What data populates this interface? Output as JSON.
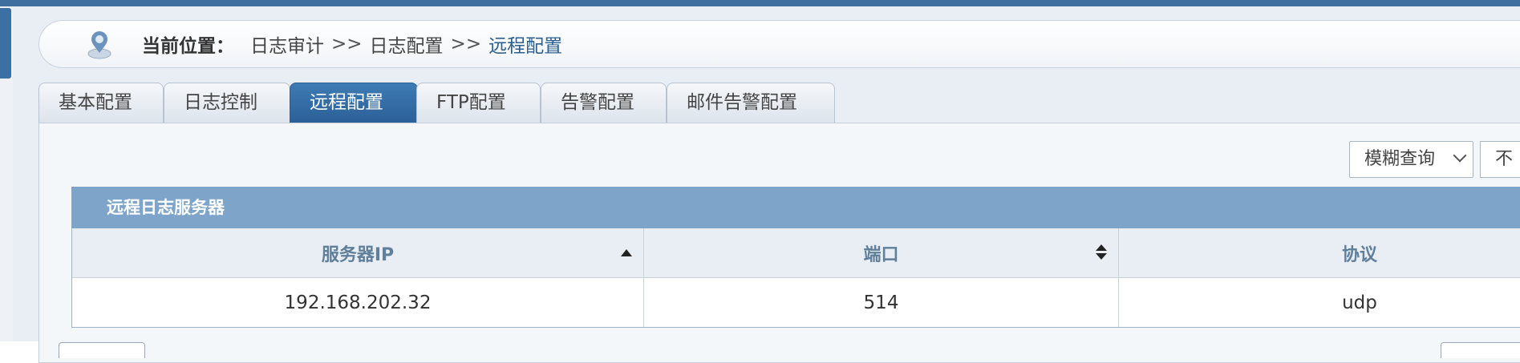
{
  "breadcrumb": {
    "label": "当前位置",
    "colon": "：",
    "separator": ">>",
    "items": [
      "日志审计",
      "日志配置"
    ],
    "current": "远程配置"
  },
  "tabs": [
    {
      "label": "基本配置",
      "active": false
    },
    {
      "label": "日志控制",
      "active": false
    },
    {
      "label": "远程配置",
      "active": true
    },
    {
      "label": "FTP配置",
      "active": false
    },
    {
      "label": "告警配置",
      "active": false
    },
    {
      "label": "邮件告警配置",
      "active": false
    }
  ],
  "search": {
    "mode_value": "模糊查询",
    "condition_value": "不"
  },
  "table": {
    "title": "远程日志服务器",
    "columns": [
      {
        "label": "服务器IP",
        "sort": "asc"
      },
      {
        "label": "端口",
        "sort": "both"
      },
      {
        "label": "协议",
        "sort": "none"
      }
    ],
    "rows": [
      {
        "ip": "192.168.202.32",
        "port": "514",
        "protocol": "udp"
      }
    ]
  },
  "colors": {
    "accent": "#2c6098",
    "table_header": "#7ea4c9",
    "breadcrumb_current": "#2b5f91"
  }
}
